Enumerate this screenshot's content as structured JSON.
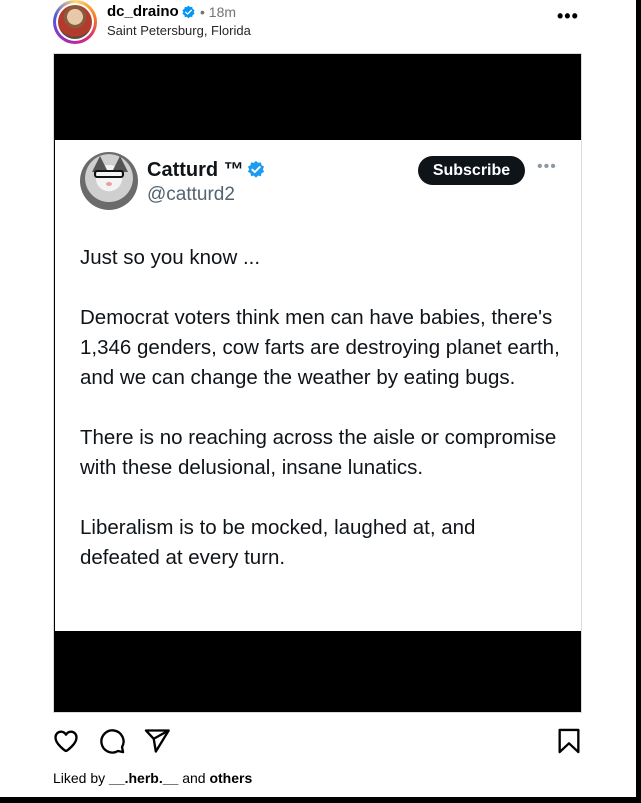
{
  "post": {
    "username": "dc_draino",
    "time": "• 18m",
    "location": "Saint Petersburg, Florida",
    "more": "•••"
  },
  "tweet": {
    "name": "Catturd ™",
    "handle": "@catturd2",
    "subscribe_label": "Subscribe",
    "more": "•••",
    "paragraphs": [
      "Just so you know ...",
      "Democrat voters think men can have babies, there's 1,346 genders, cow farts are destroying planet earth, and we can change the weather by eating bugs.",
      "There is no reaching across the aisle or compromise with these delusional, insane lunatics.",
      "Liberalism is to be mocked, laughed at, and defeated at every turn."
    ]
  },
  "likes": {
    "prefix": "Liked by ",
    "user": "__.herb.__",
    "middle": " and ",
    "others": "others"
  },
  "icons": {
    "like": "heart-icon",
    "comment": "comment-icon",
    "share": "send-icon",
    "save": "bookmark-icon",
    "verified": "verified-badge-icon"
  },
  "colors": {
    "verified_blue": "#0095f6",
    "twitter_verified": "#1d9bf0",
    "subscribe_bg": "#0f1419"
  }
}
